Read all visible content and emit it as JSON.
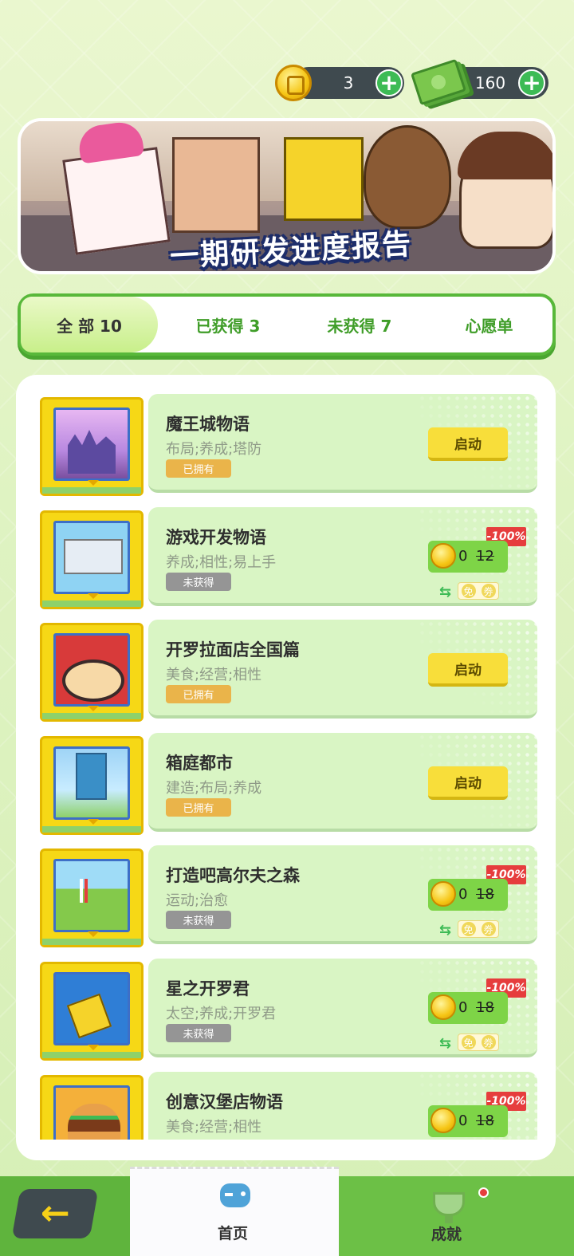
{
  "currency": {
    "coins": "3",
    "cash": "160"
  },
  "banner": {
    "title": "一期研发进度报告"
  },
  "tabs": [
    {
      "label": "全 部 10",
      "active": true
    },
    {
      "label": "已获得 3",
      "active": false
    },
    {
      "label": "未获得 7",
      "active": false
    },
    {
      "label": "心愿单",
      "active": false
    }
  ],
  "games": [
    {
      "title": "魔王城物语",
      "tags": "布局;养成;塔防",
      "status": "已拥有",
      "owned": true,
      "action": "启动"
    },
    {
      "title": "游戏开发物语",
      "tags": "养成;相性;易上手",
      "status": "未获得",
      "owned": false,
      "price_now": "0",
      "price_old": "12",
      "discount": "-100%",
      "free_label": [
        "免",
        "劵"
      ]
    },
    {
      "title": "开罗拉面店全国篇",
      "tags": "美食;经营;相性",
      "status": "已拥有",
      "owned": true,
      "action": "启动"
    },
    {
      "title": "箱庭都市",
      "tags": "建造;布局;养成",
      "status": "已拥有",
      "owned": true,
      "action": "启动"
    },
    {
      "title": "打造吧高尔夫之森",
      "tags": "运动;治愈",
      "status": "未获得",
      "owned": false,
      "price_now": "0",
      "price_old": "18",
      "discount": "-100%",
      "free_label": [
        "免",
        "劵"
      ]
    },
    {
      "title": "星之开罗君",
      "tags": "太空;养成;开罗君",
      "status": "未获得",
      "owned": false,
      "price_now": "0",
      "price_old": "18",
      "discount": "-100%",
      "free_label": [
        "免",
        "劵"
      ]
    },
    {
      "title": "创意汉堡店物语",
      "tags": "美食;经营;相性",
      "status": "",
      "owned": false,
      "price_now": "0",
      "price_old": "18",
      "discount": "-100%"
    }
  ],
  "bottom_nav": {
    "back": "←",
    "home": "首页",
    "achievements": "成就"
  },
  "colors": {
    "accent_green": "#58b83a",
    "launch_yellow": "#f8de3a",
    "discount_red": "#e63d3d",
    "owned_badge": "#eab44a",
    "notowned_badge": "#959595"
  }
}
